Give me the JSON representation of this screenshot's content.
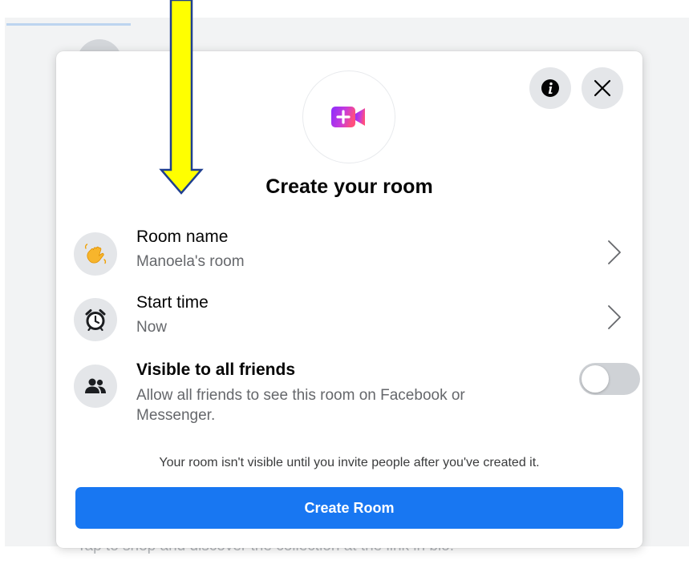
{
  "background": {
    "caption": "Tap to shop and discover the collection at the link in bio."
  },
  "modal": {
    "hero_icon": "video-room-plus-icon",
    "title": "Create your room",
    "info_icon": "info-icon",
    "close_icon": "close-icon",
    "rows": [
      {
        "icon": "waving-hand-icon",
        "title": "Room name",
        "subtitle": "Manoela's room",
        "action_icon": "chevron-right-icon"
      },
      {
        "icon": "alarm-clock-icon",
        "title": "Start time",
        "subtitle": "Now",
        "action_icon": "chevron-right-icon"
      },
      {
        "icon": "friends-icon",
        "title": "Visible to all friends",
        "subtitle": "Allow all friends to see this room on Facebook or Messenger.",
        "toggle_on": false
      }
    ],
    "note": "Your room isn't visible until you invite people after you've created it.",
    "create_button_label": "Create Room"
  },
  "annotation": {
    "icon": "yellow-arrow-down-icon"
  },
  "colors": {
    "accent": "#1877f2",
    "toggle_off": "#cfd2d6",
    "icon_bg": "#e4e6e9",
    "room_icon_gradient_start": "#a033ff",
    "room_icon_gradient_end": "#ff5280",
    "annotation_arrow": "#ffff00"
  }
}
